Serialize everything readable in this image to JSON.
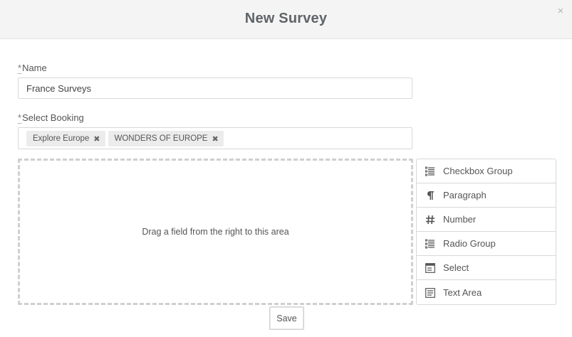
{
  "modal": {
    "title": "New Survey",
    "close_symbol": "×"
  },
  "form": {
    "required_marker": "*",
    "name_label": "Name",
    "name_value": "France Surveys",
    "booking_label": "Select Booking",
    "bookings": [
      {
        "label": "Explore Europe",
        "remove_symbol": "✖"
      },
      {
        "label": "WONDERS OF EUROPE",
        "remove_symbol": "✖"
      }
    ],
    "drop_zone_text": "Drag a field from the right to this area"
  },
  "fields": [
    {
      "label": "Checkbox Group",
      "icon": "list-check-icon"
    },
    {
      "label": "Paragraph",
      "icon": "paragraph-icon"
    },
    {
      "label": "Number",
      "icon": "hash-icon"
    },
    {
      "label": "Radio Group",
      "icon": "list-radio-icon"
    },
    {
      "label": "Select",
      "icon": "select-box-icon"
    },
    {
      "label": "Text Area",
      "icon": "text-area-icon"
    }
  ],
  "actions": {
    "save_label": "Save"
  }
}
